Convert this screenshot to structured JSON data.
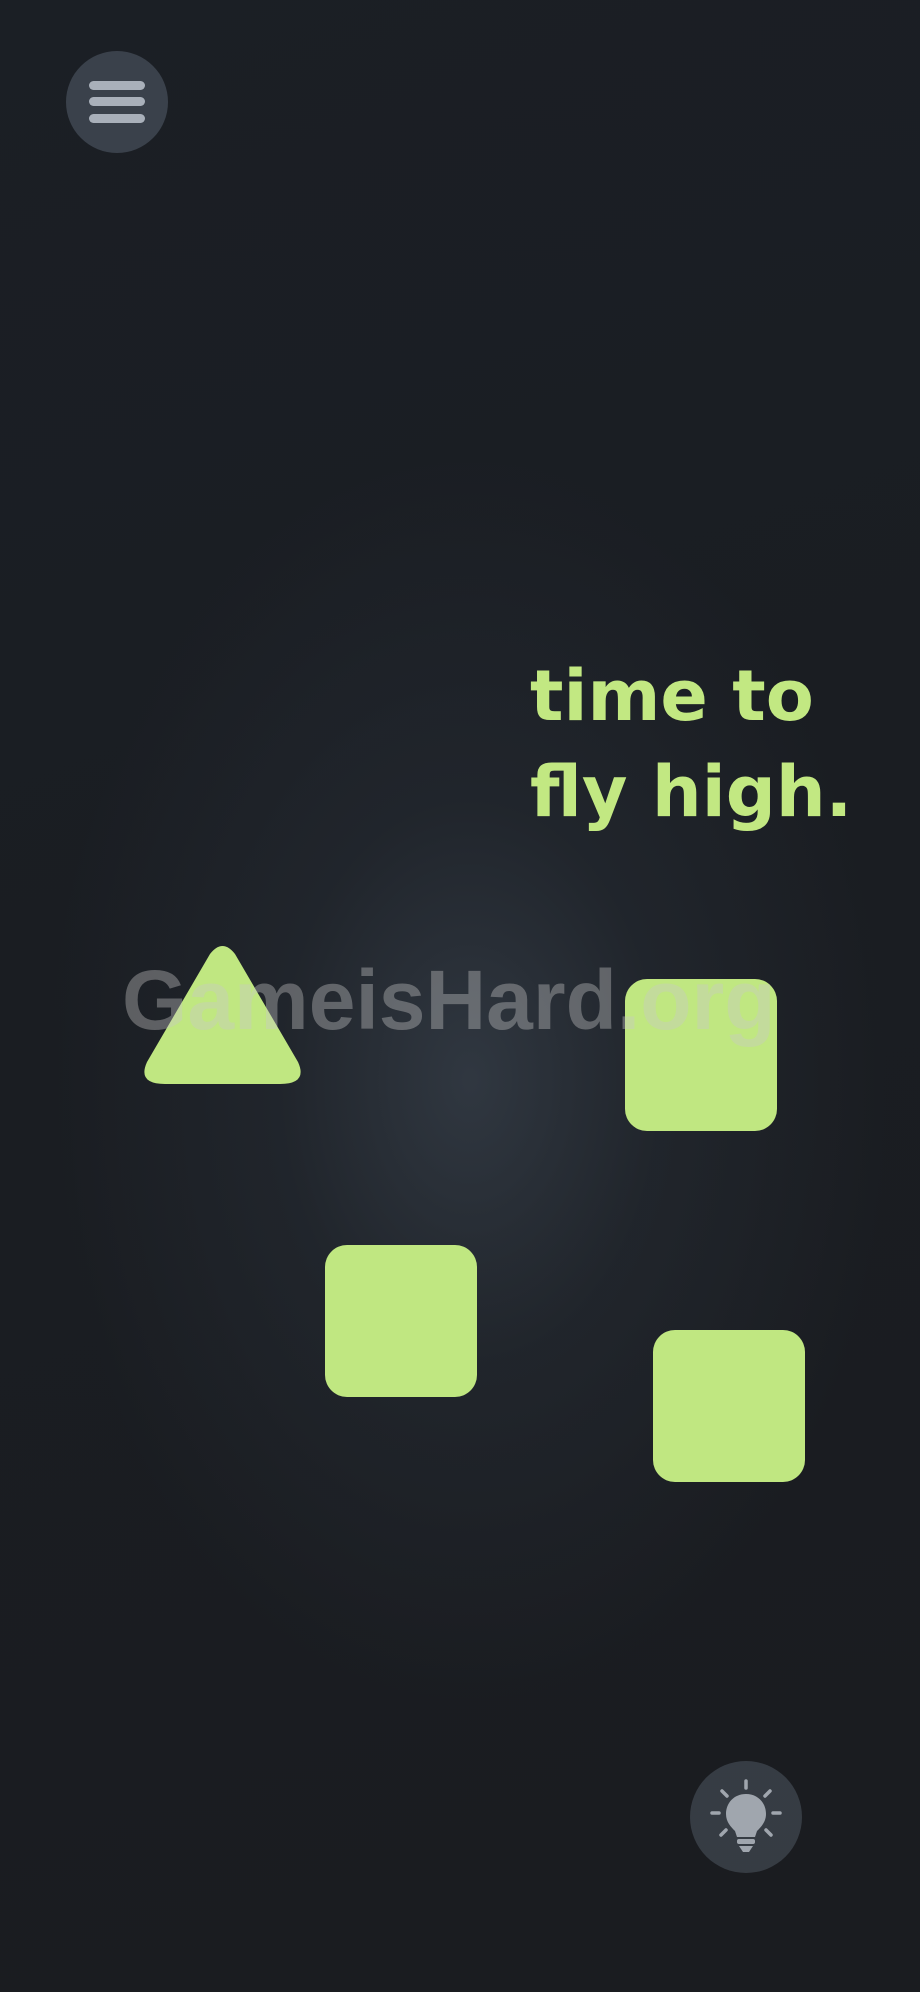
{
  "game": {
    "level_text_line1": "time to",
    "level_text_line2": "fly high.",
    "watermark": "GameisHard.org"
  },
  "icons": {
    "menu": "hamburger-menu-icon",
    "hint": "lightbulb-icon"
  },
  "colors": {
    "background": "#191c21",
    "accent": "#c2e882",
    "button_bg": "#464e58",
    "icon": "#a9b0ba"
  }
}
